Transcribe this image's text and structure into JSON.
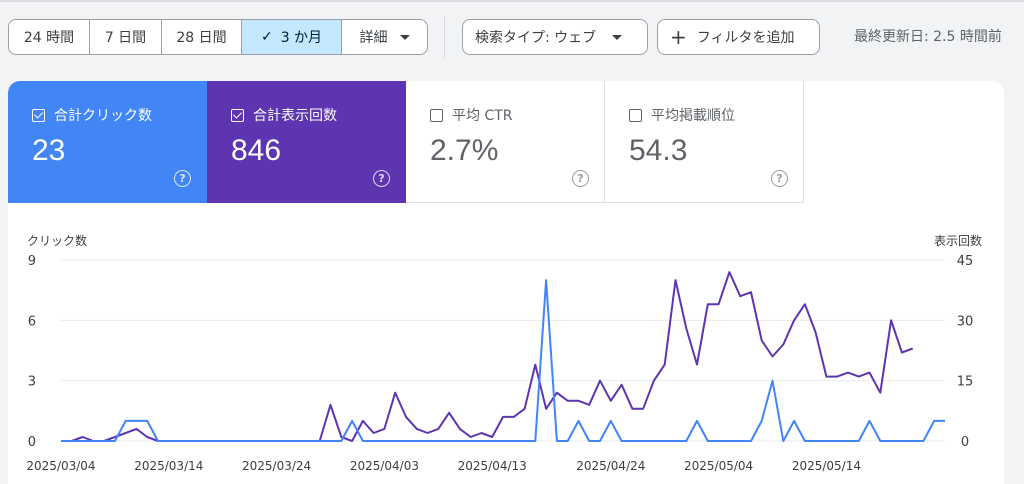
{
  "toolbar": {
    "ranges": [
      "24 時間",
      "7 日間",
      "28 日間",
      "3 か月",
      "詳細"
    ],
    "active_index": 3,
    "search_type": "検索タイプ: ウェブ",
    "add_filter": "フィルタを追加",
    "last_updated": "最終更新日: 2.5 時間前"
  },
  "metrics": [
    {
      "label": "合計クリック数",
      "value": "23",
      "checked": true
    },
    {
      "label": "合計表示回数",
      "value": "846",
      "checked": true
    },
    {
      "label": "平均 CTR",
      "value": "2.7%",
      "checked": false
    },
    {
      "label": "平均掲載順位",
      "value": "54.3",
      "checked": false
    }
  ],
  "colors": {
    "clicks": "#4285f4",
    "impressions": "#5e35b1",
    "active": "#c2e7ff"
  },
  "chart_data": {
    "type": "line",
    "y_left_label": "クリック数",
    "y_right_label": "表示回数",
    "y_left_ticks": [
      0,
      3,
      6,
      9
    ],
    "y_right_ticks": [
      0,
      15,
      30,
      45
    ],
    "ylim_left": [
      0,
      9
    ],
    "ylim_right": [
      0,
      45
    ],
    "x_tick_labels": [
      "2025/03/04",
      "2025/03/14",
      "2025/03/24",
      "2025/04/03",
      "2025/04/13",
      "2025/04/24",
      "2025/05/04",
      "2025/05/14"
    ],
    "x_tick_index": [
      0,
      10,
      20,
      30,
      40,
      51,
      61,
      71
    ],
    "series": [
      {
        "name": "合計クリック数",
        "axis": "left",
        "values": [
          0,
          0,
          0,
          0,
          0,
          0,
          1,
          1,
          1,
          0,
          0,
          0,
          0,
          0,
          0,
          0,
          0,
          0,
          0,
          0,
          0,
          0,
          0,
          0,
          0,
          0,
          0,
          1,
          0,
          0,
          0,
          0,
          0,
          0,
          0,
          0,
          0,
          0,
          0,
          0,
          0,
          0,
          0,
          0,
          0,
          8,
          0,
          0,
          1,
          0,
          0,
          1,
          0,
          0,
          0,
          0,
          0,
          0,
          0,
          1,
          0,
          0,
          0,
          0,
          0,
          1,
          3,
          0,
          1,
          0,
          0,
          0,
          0,
          0,
          0,
          1,
          0,
          0,
          0,
          0,
          0,
          1,
          1
        ]
      },
      {
        "name": "合計表示回数",
        "axis": "right",
        "values": [
          0,
          0,
          1,
          0,
          0,
          1,
          2,
          3,
          1,
          0,
          0,
          0,
          0,
          0,
          0,
          0,
          0,
          0,
          0,
          0,
          0,
          0,
          0,
          0,
          0,
          9,
          1,
          0,
          5,
          2,
          3,
          12,
          6,
          3,
          2,
          3,
          7,
          3,
          1,
          2,
          1,
          6,
          6,
          8,
          19,
          8,
          12,
          10,
          10,
          9,
          15,
          10,
          14,
          8,
          8,
          15,
          19,
          40,
          28,
          19,
          34,
          34,
          42,
          36,
          37,
          25,
          21,
          24,
          30,
          34,
          27,
          16,
          16,
          17,
          16,
          17,
          12,
          30,
          22,
          23
        ]
      }
    ]
  }
}
